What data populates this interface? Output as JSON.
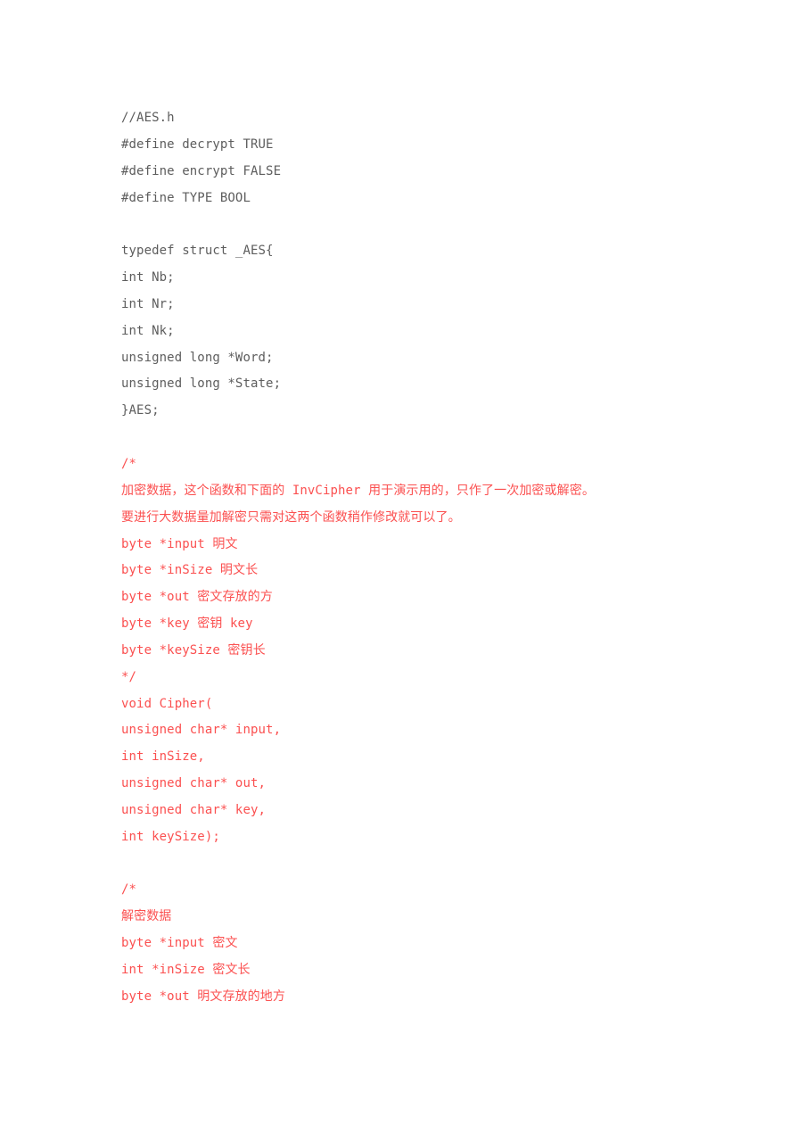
{
  "document": {
    "kind": "source-code-listing",
    "language": "c-header",
    "background_color": "#ffffff",
    "colors": {
      "code_gray": "#5d5d5d",
      "comment_red": "#fb5050"
    },
    "blocks": [
      {
        "id": "header-defines",
        "color": "code_gray",
        "lines": [
          "//AES.h",
          "#define decrypt TRUE",
          "#define encrypt FALSE",
          "#define TYPE BOOL"
        ]
      },
      {
        "id": "spacer-1",
        "color": "code_gray",
        "lines": [
          ""
        ]
      },
      {
        "id": "struct-aes",
        "color": "code_gray",
        "lines": [
          "typedef struct _AES{",
          "int Nb;",
          "int Nr;",
          "int Nk;",
          "unsigned long *Word;",
          "unsigned long *State;",
          "}AES;"
        ]
      },
      {
        "id": "spacer-2",
        "color": "code_gray",
        "lines": [
          ""
        ]
      },
      {
        "id": "cipher-comment",
        "color": "comment_red",
        "lines": [
          "/*",
          "加密数据，这个函数和下面的 InvCipher 用于演示用的，只作了一次加密或解密。",
          "要进行大数据量加解密只需对这两个函数稍作修改就可以了。",
          "byte *input 明文",
          "byte *inSize 明文长",
          "byte *out 密文存放的方",
          "byte *key 密钥 key",
          "byte *keySize 密钥长",
          "*/"
        ],
        "wrapped_line_indexes": [
          1
        ]
      },
      {
        "id": "cipher-decl",
        "color": "comment_red",
        "lines": [
          "void Cipher(",
          "unsigned char* input,",
          "int inSize,",
          "unsigned char* out,",
          "unsigned char* key,",
          "int keySize);"
        ]
      },
      {
        "id": "spacer-3",
        "color": "comment_red",
        "lines": [
          ""
        ]
      },
      {
        "id": "invcipher-comment",
        "color": "comment_red",
        "lines": [
          "/*",
          "解密数据",
          "byte *input 密文",
          "int *inSize 密文长",
          "byte *out 明文存放的地方"
        ]
      }
    ]
  }
}
